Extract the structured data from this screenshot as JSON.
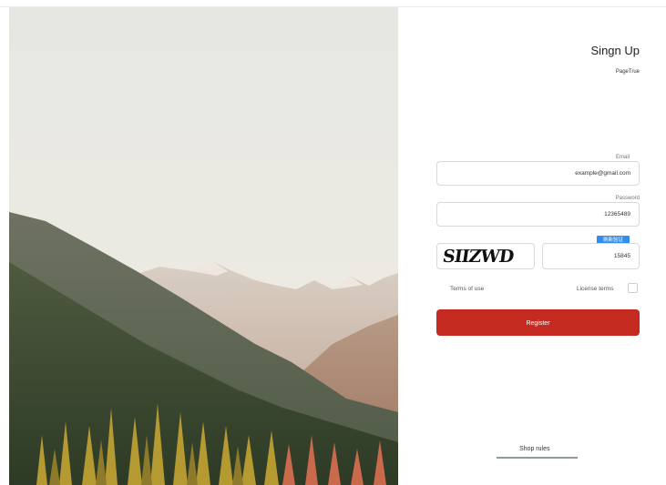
{
  "panel": {
    "title": "Singn Up",
    "subtitle": "PageTrue"
  },
  "form": {
    "email": {
      "label": "Email",
      "value": "example@gmail.com"
    },
    "password": {
      "label": "Password",
      "value": "12365489"
    },
    "captcha": {
      "image_text": "SIIZWD",
      "value": "15845",
      "refresh_label": "刷新验证"
    },
    "terms_label": "Terms of use",
    "license_label": "License terms",
    "license_checked": false,
    "register_label": "Register"
  },
  "footer": {
    "shop_rules": "Shop rules"
  },
  "colors": {
    "accent": "#c52a20",
    "badge": "#2f8ff0"
  }
}
